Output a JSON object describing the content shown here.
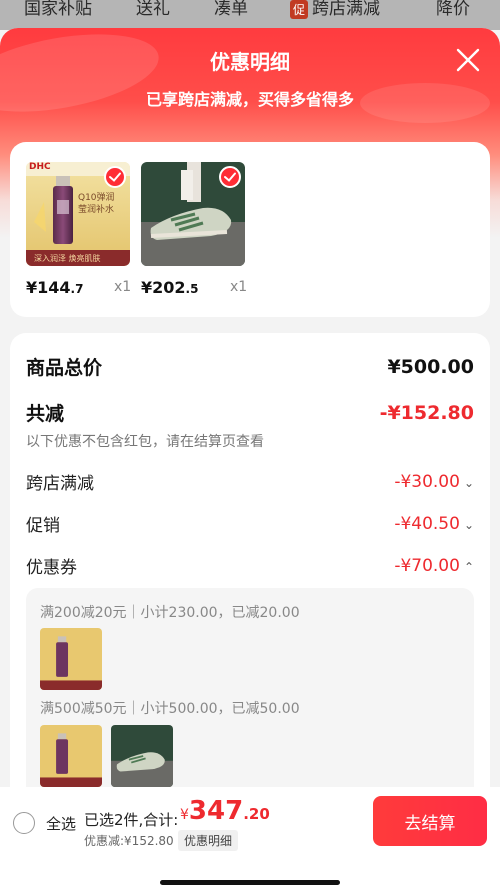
{
  "top_categories": [
    {
      "label": "国家补贴"
    },
    {
      "label": "送礼"
    },
    {
      "label": "凑单"
    },
    {
      "label": "跨店满减",
      "badge": "促"
    },
    {
      "label": "降价"
    }
  ],
  "sheet": {
    "title": "优惠明细",
    "subtitle": "已享跨店满减，买得多省得多"
  },
  "products": [
    {
      "price_main": "¥144",
      "price_dec": ".7",
      "qty": "x1",
      "brand_text": "DHC",
      "pack_text": "Q10弹润 莹润补水",
      "band_text": "深入润泽 焕亮肌肤",
      "icon": "skincare-product-image"
    },
    {
      "price_main": "¥202",
      "price_dec": ".5",
      "qty": "x1",
      "icon": "sneaker-product-image"
    }
  ],
  "summary": {
    "total_label": "商品总价",
    "total_value": "¥500.00",
    "reduce_label": "共减",
    "reduce_value": "-¥152.80",
    "note": "以下优惠不包含红包，请在结算页查看",
    "items": [
      {
        "label": "跨店满减",
        "value": "-¥30.00",
        "chevron": "⌄"
      },
      {
        "label": "促销",
        "value": "-¥40.50",
        "chevron": "⌄"
      },
      {
        "label": "优惠券",
        "value": "-¥70.00",
        "chevron": "⌃"
      }
    ]
  },
  "coupons": [
    {
      "text": "满200减20元｜小计230.00，已减20.00"
    },
    {
      "text": "满500减50元｜小计500.00，已减50.00"
    }
  ],
  "bottom": {
    "select_all": "全选",
    "selected_count": "已选2件,合计:",
    "currency": "¥",
    "total_int": "347",
    "total_dec": ".20",
    "discount_line": "优惠减:¥152.80",
    "detail_tag": "优惠明细",
    "checkout": "去结算"
  },
  "colors": {
    "accent": "#ee2a2f",
    "header_red": "#ff3b3f"
  }
}
